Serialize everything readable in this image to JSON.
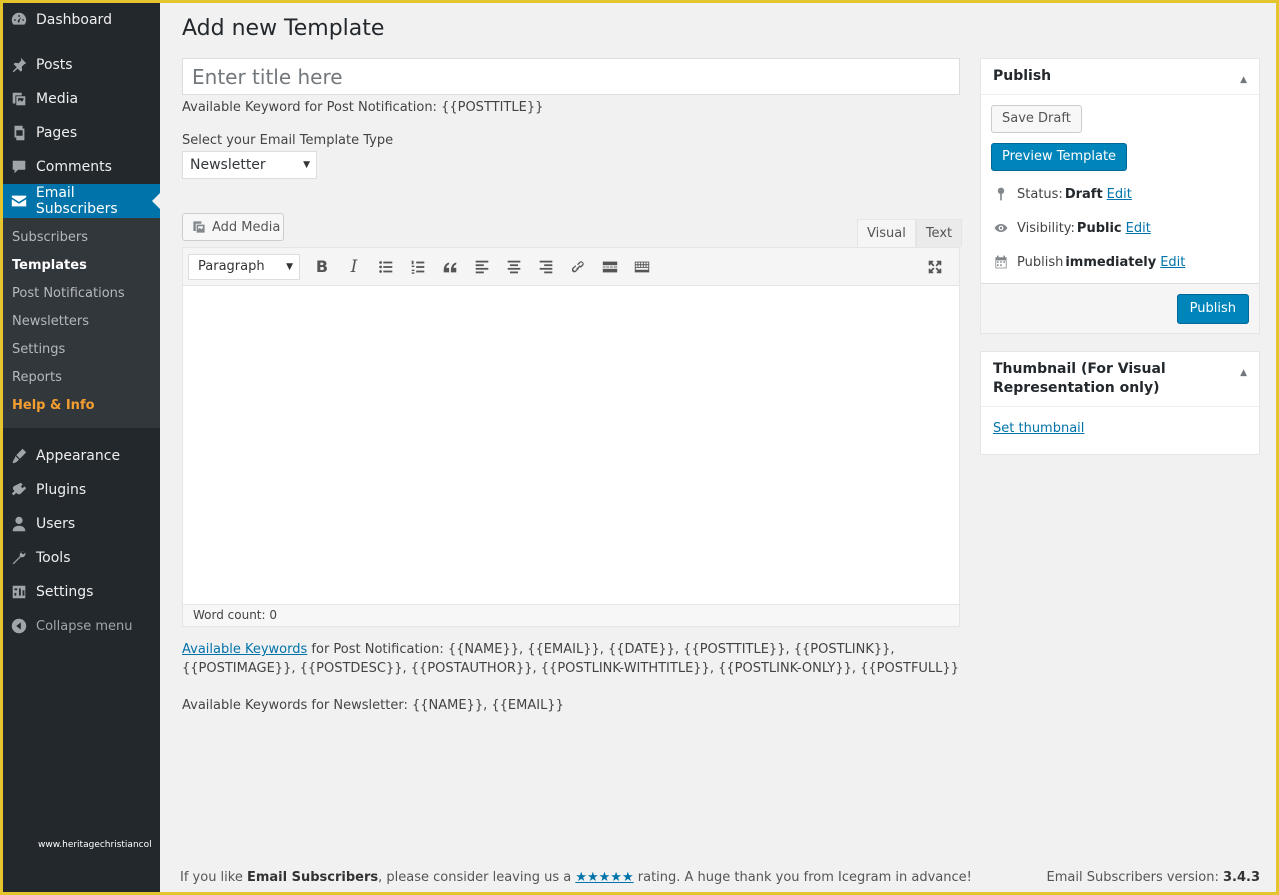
{
  "sidebar": {
    "items": [
      {
        "label": "Dashboard",
        "icon": "dashboard-icon"
      },
      {
        "label": "Posts",
        "icon": "pin-icon"
      },
      {
        "label": "Media",
        "icon": "media-icon"
      },
      {
        "label": "Pages",
        "icon": "pages-icon"
      },
      {
        "label": "Comments",
        "icon": "comments-icon"
      },
      {
        "label": "Email Subscribers",
        "icon": "email-icon"
      }
    ],
    "submenu": [
      "Subscribers",
      "Templates",
      "Post Notifications",
      "Newsletters",
      "Settings",
      "Reports",
      "Help & Info"
    ],
    "items2": [
      {
        "label": "Appearance",
        "icon": "brush-icon"
      },
      {
        "label": "Plugins",
        "icon": "plugin-icon"
      },
      {
        "label": "Users",
        "icon": "users-icon"
      },
      {
        "label": "Tools",
        "icon": "wrench-icon"
      },
      {
        "label": "Settings",
        "icon": "settings-icon"
      }
    ],
    "collapse": "Collapse menu",
    "watermark": "www.heritagechristiancol"
  },
  "main": {
    "title": "Add new Template",
    "title_placeholder": "Enter title here",
    "keyword_line": "Available Keyword for Post Notification: {{POSTTITLE}}",
    "select_label": "Select your Email Template Type",
    "template_type": "Newsletter",
    "add_media": "Add Media",
    "tab_visual": "Visual",
    "tab_text": "Text",
    "paragraph": "Paragraph",
    "word_count": "Word count: 0",
    "kw_link": "Available Keywords",
    "kw_post": " for Post Notification: {{NAME}}, {{EMAIL}}, {{DATE}}, {{POSTTITLE}}, {{POSTLINK}}, {{POSTIMAGE}}, {{POSTDESC}}, {{POSTAUTHOR}}, {{POSTLINK-WITHTITLE}}, {{POSTLINK-ONLY}}, {{POSTFULL}}",
    "kw_news": "Available Keywords for Newsletter: {{NAME}}, {{EMAIL}}"
  },
  "publish": {
    "title": "Publish",
    "save_draft": "Save Draft",
    "preview": "Preview Template",
    "status_label": "Status:",
    "status_value": "Draft",
    "visibility_label": "Visibility:",
    "visibility_value": "Public",
    "publish_label": "Publish",
    "publish_value": "immediately",
    "edit": "Edit",
    "publish_button": "Publish"
  },
  "thumbnail": {
    "title": "Thumbnail (For Visual Representation only)",
    "link": "Set thumbnail"
  },
  "footer": {
    "left_prefix": "If you like ",
    "left_brand": "Email Subscribers",
    "left_middle": ", please consider leaving us a ",
    "stars": "★★★★★",
    "left_suffix": " rating. A huge thank you from Icegram in advance!",
    "right_prefix": "Email Subscribers version: ",
    "version": "3.4.3"
  },
  "colors": {
    "sidebar_bg": "#23282d",
    "submenu_bg": "#32373c",
    "active": "#0073aa",
    "primary_button": "#0085ba",
    "help_highlight": "#f59e30",
    "frame": "#e5c52d"
  }
}
